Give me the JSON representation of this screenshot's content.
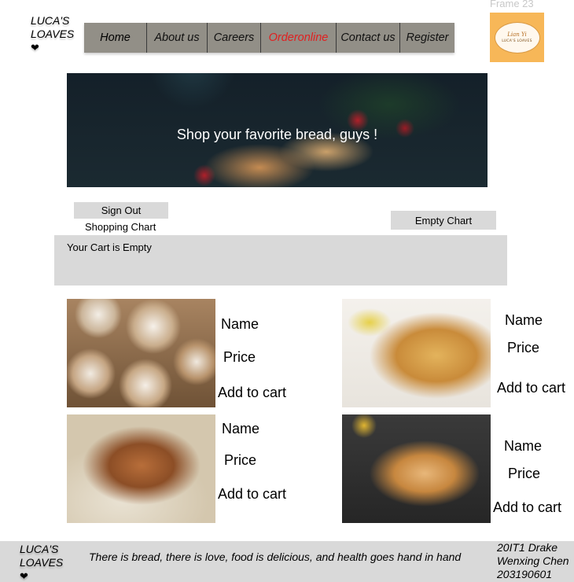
{
  "frame_label": "Frame 23",
  "brand": {
    "line1": "LUCA'S",
    "line2": "LOAVES",
    "heart": "❤"
  },
  "nav": {
    "items": [
      {
        "label": "Home"
      },
      {
        "label": "About us"
      },
      {
        "label": "Careers"
      },
      {
        "label": "Orderonline"
      },
      {
        "label": "Contact us"
      },
      {
        "label": "Register"
      }
    ],
    "active_color": "#e02020",
    "bar_color": "#928f87"
  },
  "logo": {
    "top_text": "Lian Yi",
    "bottom_text": "LUCA'S LOAVES",
    "bg_color": "#f7b758"
  },
  "hero": {
    "text": "Shop your favorite bread, guys !"
  },
  "actions": {
    "sign_out": "Sign Out",
    "empty_chart": "Empty Chart"
  },
  "cart": {
    "title": "Shopping Chart",
    "empty_message": "Your Cart is Empty"
  },
  "products": [
    {
      "name": "Name",
      "price": "Price",
      "add_to_cart": "Add to cart"
    },
    {
      "name": "Name",
      "price": "Price",
      "add_to_cart": "Add to cart"
    },
    {
      "name": "Name",
      "price": "Price",
      "add_to_cart": "Add to cart"
    },
    {
      "name": "Name",
      "price": "Price",
      "add_to_cart": "Add to cart"
    }
  ],
  "footer": {
    "brand_line1": "LUCA'S",
    "brand_line2": "LOAVES",
    "heart": "❤",
    "tagline": "There is bread, there is love, food is delicious, and health goes hand in hand",
    "credit_line1": "20IT1 Drake",
    "credit_line2": "Wenxing Chen",
    "credit_line3": "203190601"
  }
}
